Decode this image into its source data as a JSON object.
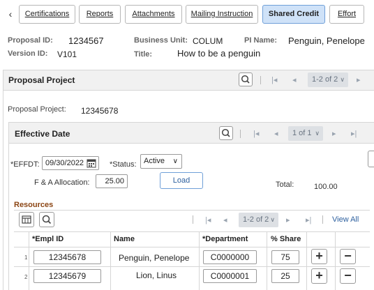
{
  "tabs": [
    {
      "label": "Certifications",
      "active": false
    },
    {
      "label": "Reports",
      "active": false
    },
    {
      "label": "Attachments",
      "active": false
    },
    {
      "label": "Mailing Instruction",
      "active": false
    },
    {
      "label": "Shared Credit",
      "active": true
    },
    {
      "label": "Effort",
      "active": false
    }
  ],
  "header": {
    "proposal_id_label": "Proposal ID:",
    "proposal_id": "1234567",
    "business_unit_label": "Business Unit:",
    "business_unit": "COLUM",
    "pi_name_label": "PI Name:",
    "pi_name": "Penguin, Penelope",
    "version_id_label": "Version ID:",
    "version_id": "V101",
    "title_label": "Title:",
    "title": "How to be a penguin"
  },
  "proposal_project_panel": {
    "title": "Proposal Project",
    "pager": "1-2 of 2",
    "field_label": "Proposal Project:",
    "field_value": "12345678"
  },
  "effective_date_panel": {
    "title": "Effective Date",
    "pager": "1 of 1",
    "effdt_label": "*EFFDT:",
    "effdt_value": "09/30/2022",
    "status_label": "*Status:",
    "status_value": "Active",
    "fa_label": "F & A Allocation:",
    "fa_value": "25.00",
    "load_button": "Load",
    "total_label": "Total:",
    "total_value": "100.00"
  },
  "resources": {
    "title": "Resources",
    "pager": "1-2 of 2",
    "view_all": "View All",
    "columns": [
      "*Empl ID",
      "Name",
      "*Department",
      "% Share"
    ],
    "rows": [
      {
        "num": "1",
        "empl_id": "12345678",
        "name": "Penguin, Penelope",
        "department": "C0000000",
        "share": "75"
      },
      {
        "num": "2",
        "empl_id": "12345679",
        "name": "Lion, Linus",
        "department": "C0000001",
        "share": "25"
      }
    ]
  },
  "icons": {
    "tab_scroll": "chevron-left-icon",
    "search": "search-icon",
    "first": "first-page-icon",
    "prev": "previous-icon",
    "next": "next-icon",
    "last": "last-page-icon",
    "calendar": "calendar-icon",
    "grid_settings": "grid-settings-icon",
    "add": "add-row-icon",
    "delete": "delete-row-icon"
  }
}
